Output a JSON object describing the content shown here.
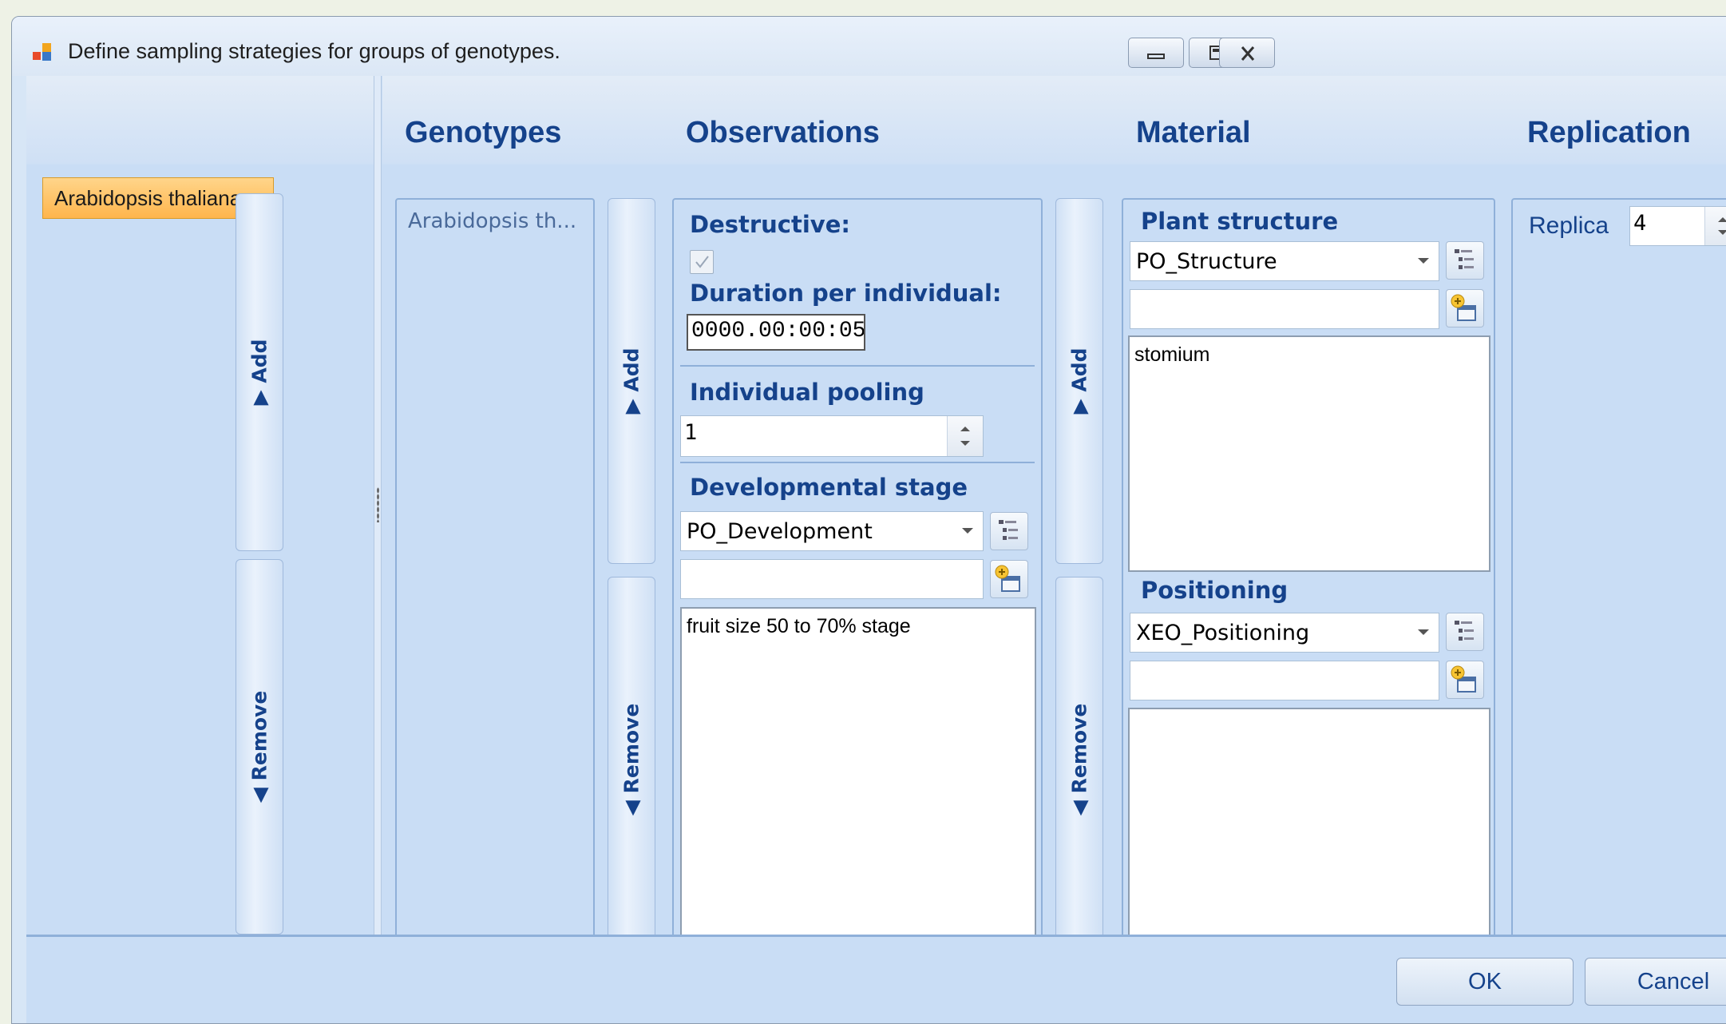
{
  "window": {
    "title": "Define sampling strategies for groups of genotypes."
  },
  "headers": {
    "genotypes": "Genotypes",
    "observations": "Observations",
    "material": "Material",
    "replication": "Replication"
  },
  "left": {
    "selected_group": "Arabidopsis thaliana...."
  },
  "genotypes_list": {
    "items": [
      "Arabidopsis th..."
    ]
  },
  "buttons": {
    "add": "Add",
    "remove": "Remove",
    "ok": "OK",
    "cancel": "Cancel"
  },
  "observations": {
    "destructive_label": "Destructive:",
    "destructive_checked": true,
    "duration_label": "Duration per individual:",
    "duration_value": "0000.00:00:05",
    "pooling_label": "Individual pooling",
    "pooling_value": "1",
    "dev_stage_label": "Developmental stage",
    "dev_stage_ontology": "PO_Development",
    "dev_stage_search": "",
    "dev_stage_items": [
      "fruit size 50 to 70% stage"
    ]
  },
  "material": {
    "structure_label": "Plant structure",
    "structure_ontology": "PO_Structure",
    "structure_search": "",
    "structure_items": [
      "stomium"
    ],
    "positioning_label": "Positioning",
    "positioning_ontology": "XEO_Positioning",
    "positioning_search": ""
  },
  "replication": {
    "replica_label": "Replica",
    "replica_value": "4"
  },
  "icons": {
    "tree": "ontology-tree-icon",
    "add_term": "add-term-icon"
  }
}
